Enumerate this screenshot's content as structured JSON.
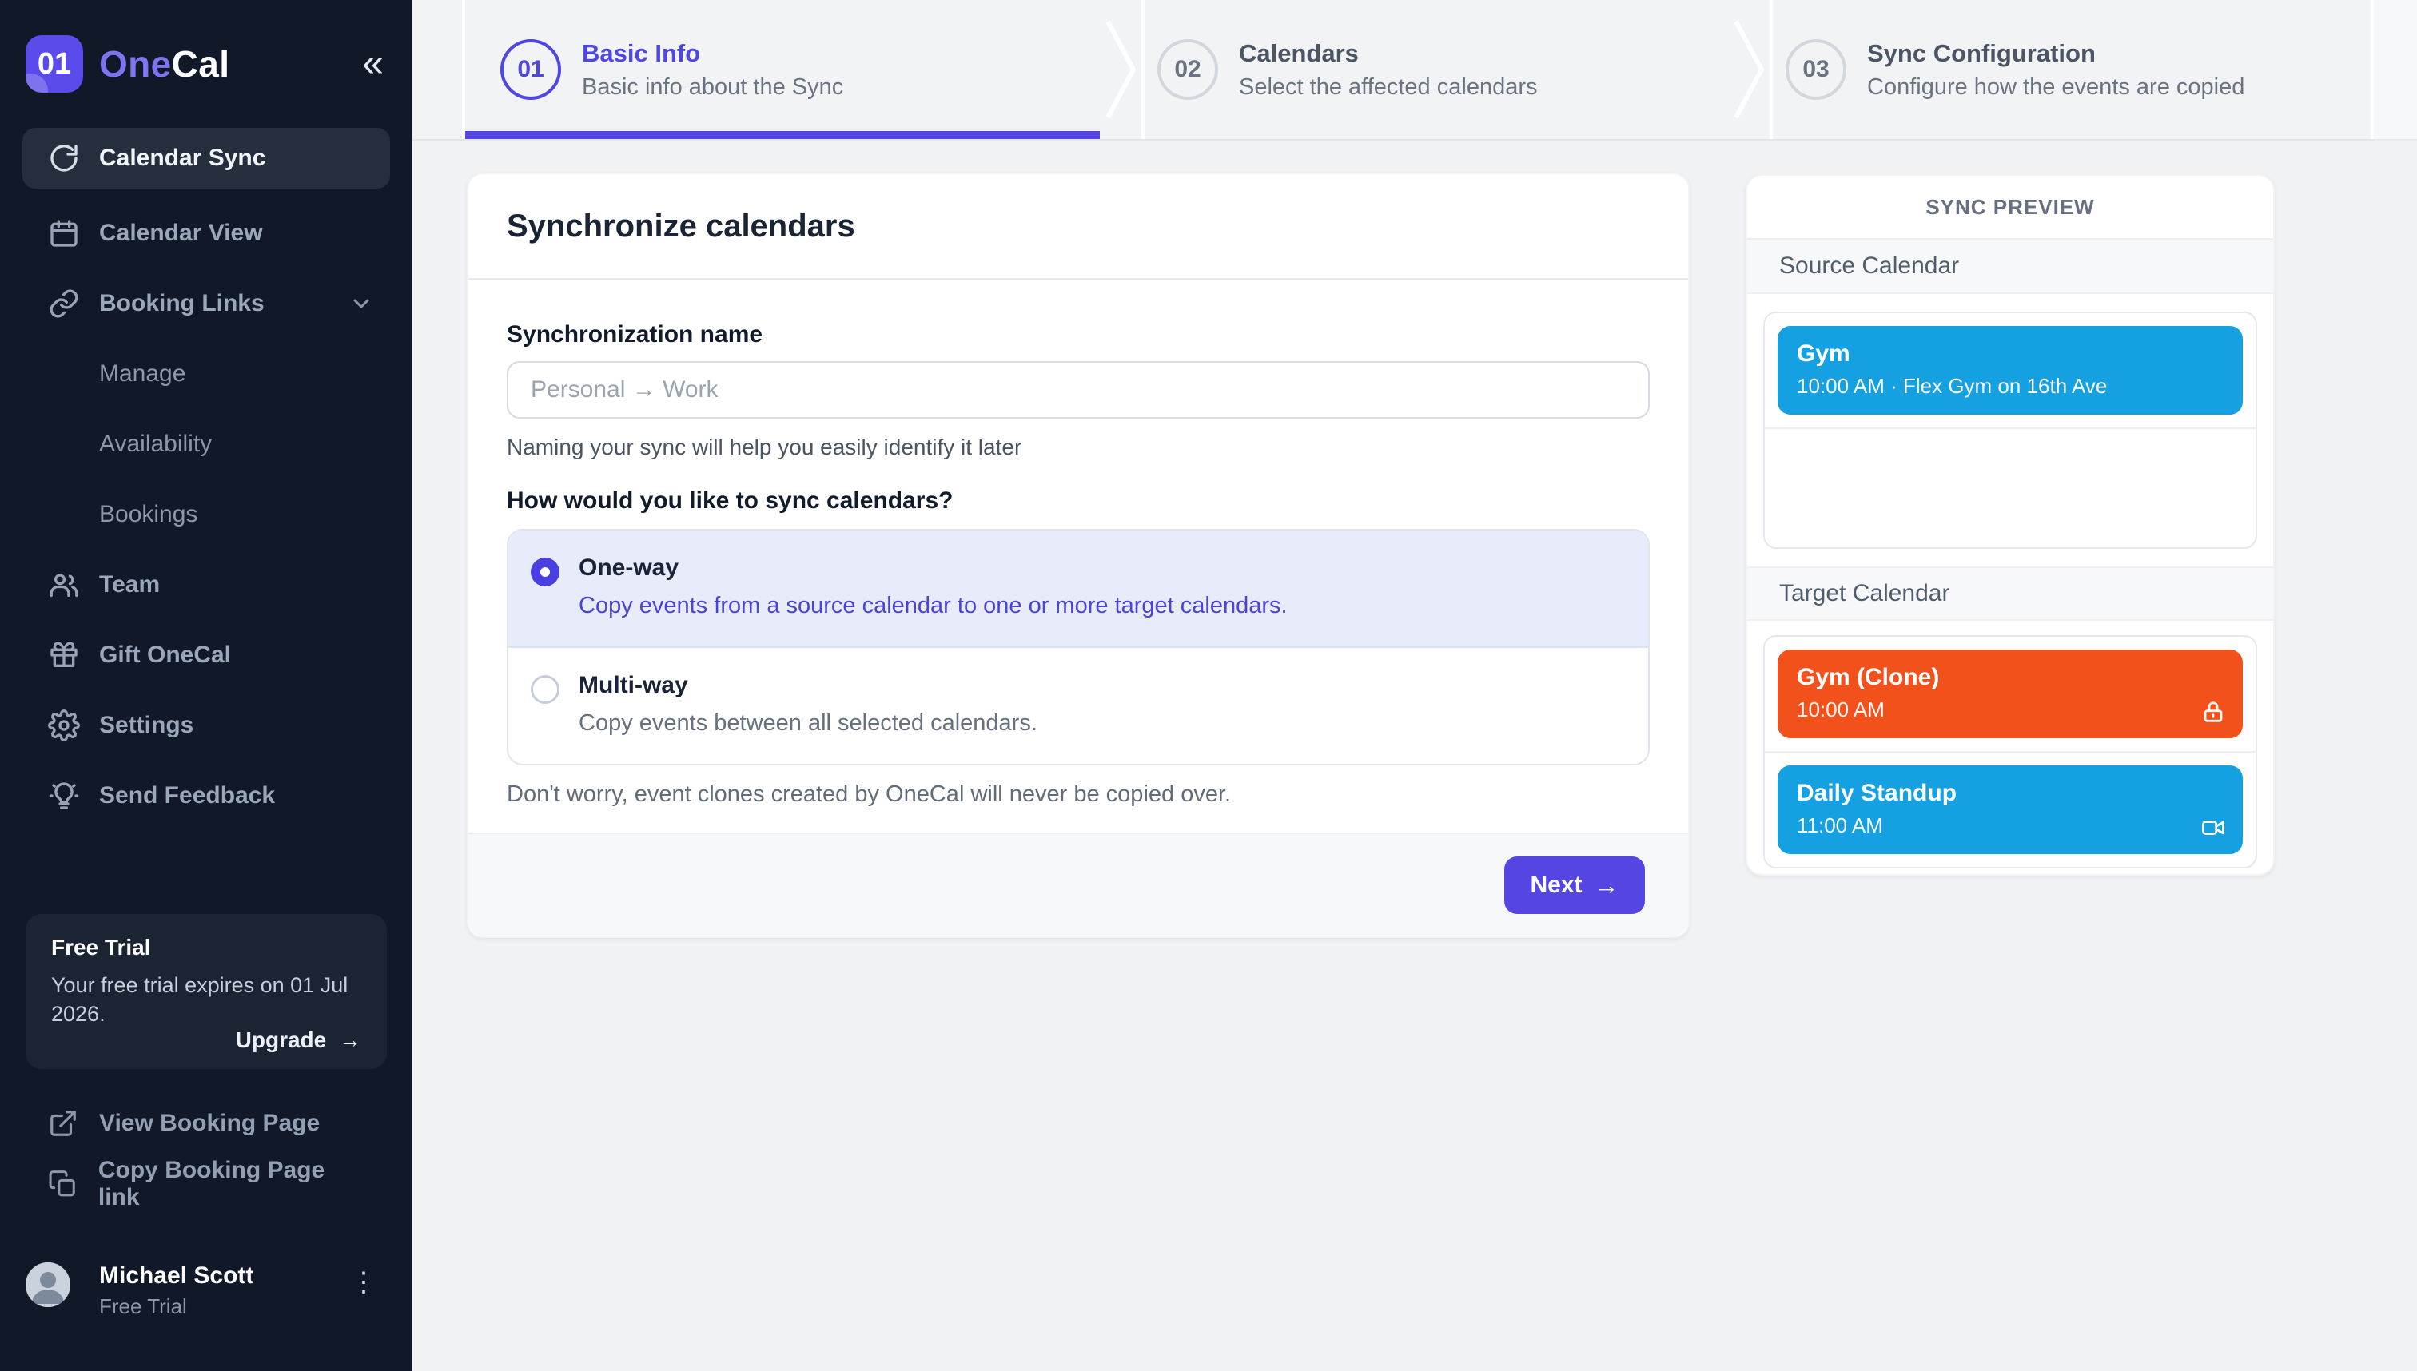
{
  "brand": {
    "logo_badge": "01",
    "name_part1": "One",
    "name_part2": "Cal"
  },
  "icons": {
    "collapse": "«",
    "ellipsis_vertical": "⋮",
    "arrow_right": "→"
  },
  "colors": {
    "accent": "#5546E4",
    "accent_text": "#4F46E5",
    "sidebar_bg": "#111928",
    "event_blue": "#15A1E1",
    "event_orange": "#F3511C"
  },
  "sidebar": {
    "items": {
      "calendar_sync": "Calendar Sync",
      "calendar_view": "Calendar View",
      "booking_links": "Booking Links",
      "manage": "Manage",
      "availability": "Availability",
      "bookings": "Bookings",
      "team": "Team",
      "gift_onecal": "Gift OneCal",
      "settings": "Settings",
      "send_feedback": "Send Feedback"
    },
    "trial": {
      "title": "Free Trial",
      "message": "Your free trial expires on 01 Jul 2026.",
      "action": "Upgrade"
    },
    "links": {
      "view_booking": "View Booking Page",
      "copy_booking": "Copy Booking Page link"
    },
    "user": {
      "name": "Michael Scott",
      "plan": "Free Trial"
    }
  },
  "stepper": {
    "steps": [
      {
        "number": "01",
        "title": "Basic Info",
        "subtitle": "Basic info about the Sync"
      },
      {
        "number": "02",
        "title": "Calendars",
        "subtitle": "Select the affected calendars"
      },
      {
        "number": "03",
        "title": "Sync Configuration",
        "subtitle": "Configure how the events are copied"
      }
    ]
  },
  "form": {
    "title": "Synchronize calendars",
    "name_label": "Synchronization name",
    "name_placeholder": "Personal → Work",
    "name_help": "Naming your sync will help you easily identify it later",
    "question": "How would you like to sync calendars?",
    "options": [
      {
        "title": "One-way",
        "description": "Copy events from a source calendar to one or more target calendars."
      },
      {
        "title": "Multi-way",
        "description": "Copy events between all selected calendars."
      }
    ],
    "note": "Don't worry, event clones created by OneCal will never be copied over.",
    "next_label": "Next"
  },
  "preview": {
    "title": "SYNC PREVIEW",
    "source_label": "Source Calendar",
    "target_label": "Target Calendar",
    "source_events": [
      {
        "title": "Gym",
        "time": "10:00 AM · Flex Gym on 16th Ave",
        "color": "#15A1E1"
      }
    ],
    "target_events": [
      {
        "title": "Gym (Clone)",
        "time": "10:00 AM",
        "color": "#F3511C"
      },
      {
        "title": "Daily Standup",
        "time": "11:00 AM",
        "color": "#15A1E1"
      }
    ]
  }
}
